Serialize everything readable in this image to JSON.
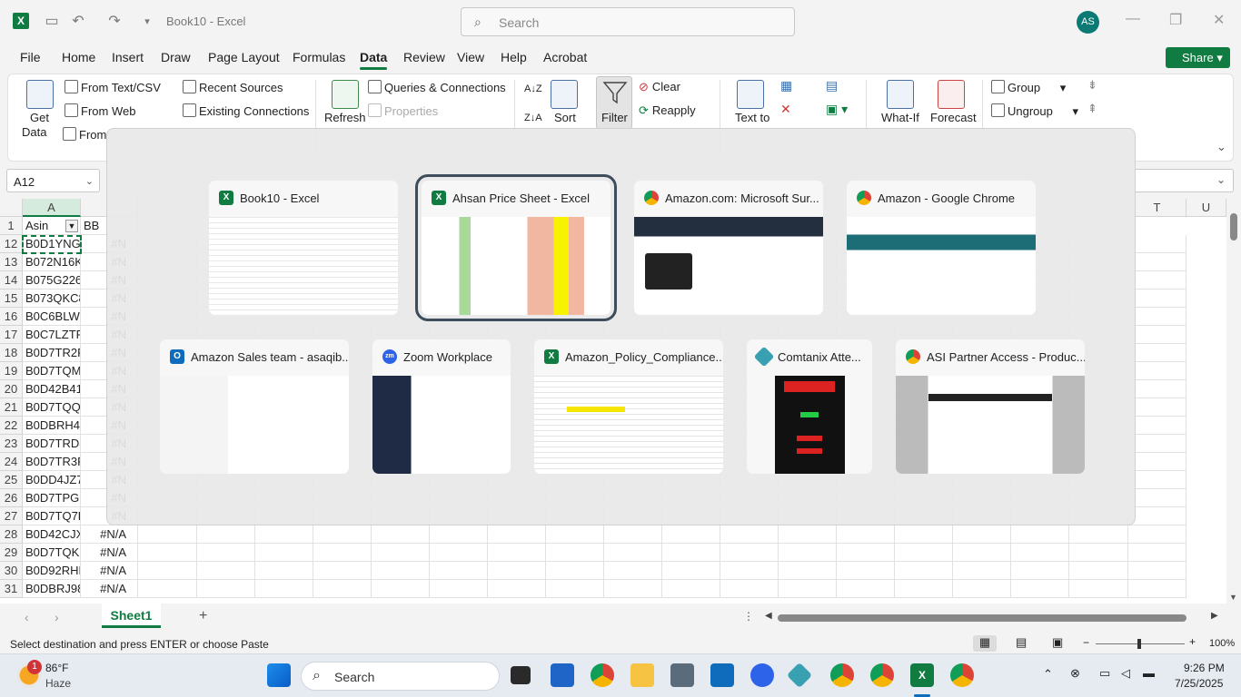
{
  "titlebar": {
    "document_title": "Book10 - Excel",
    "search_placeholder": "Search",
    "avatar_initials": "AS"
  },
  "menu": {
    "tabs": [
      "File",
      "Home",
      "Insert",
      "Draw",
      "Page Layout",
      "Formulas",
      "Data",
      "Review",
      "View",
      "Help",
      "Acrobat"
    ],
    "active": "Data",
    "share_label": "Share"
  },
  "ribbon": {
    "get_data": "Get",
    "get_data_2": "Data",
    "from_text_csv": "From Text/CSV",
    "from_web": "From Web",
    "from_partial": "From",
    "recent_sources": "Recent Sources",
    "existing_connections": "Existing Connections",
    "refresh": "Refresh",
    "queries_connections": "Queries & Connections",
    "properties": "Properties",
    "sort": "Sort",
    "filter": "Filter",
    "clear": "Clear",
    "reapply": "Reapply",
    "text_to": "Text to",
    "what_if": "What-If",
    "forecast": "Forecast",
    "group": "Group",
    "ungroup": "Ungroup"
  },
  "formula_bar": {
    "name_box": "A12"
  },
  "grid": {
    "col_a_header": "A",
    "col_t_header": "T",
    "col_u_header": "U",
    "header_row": {
      "num": "1",
      "a": "Asin",
      "b": "BB"
    },
    "rows": [
      {
        "num": "12",
        "a": "B0D1YNGV",
        "b": "#N"
      },
      {
        "num": "13",
        "a": "B072N16K",
        "b": "#N"
      },
      {
        "num": "14",
        "a": "B075G226",
        "b": "#N"
      },
      {
        "num": "15",
        "a": "B073QKC8",
        "b": "#N"
      },
      {
        "num": "16",
        "a": "B0C6BLW3",
        "b": "#N"
      },
      {
        "num": "17",
        "a": "B0C7LZTR",
        "b": "#N"
      },
      {
        "num": "18",
        "a": "B0D7TR2R",
        "b": "#N"
      },
      {
        "num": "19",
        "a": "B0D7TQM",
        "b": "#N"
      },
      {
        "num": "20",
        "a": "B0D42B41",
        "b": "#N"
      },
      {
        "num": "21",
        "a": "B0D7TQQ",
        "b": "#N"
      },
      {
        "num": "22",
        "a": "B0DBRH4N",
        "b": "#N"
      },
      {
        "num": "23",
        "a": "B0D7TRD8",
        "b": "#N"
      },
      {
        "num": "24",
        "a": "B0D7TR3F",
        "b": "#N"
      },
      {
        "num": "25",
        "a": "B0DD4JZ7",
        "b": "#N"
      },
      {
        "num": "26",
        "a": "B0D7TPGF",
        "b": "#N"
      },
      {
        "num": "27",
        "a": "B0D7TQ7R",
        "b": "#N"
      },
      {
        "num": "28",
        "a": "B0D42CJX",
        "b": "#N/A"
      },
      {
        "num": "29",
        "a": "B0D7TQKN",
        "b": "#N/A"
      },
      {
        "num": "30",
        "a": "B0D92RHD",
        "b": "#N/A"
      },
      {
        "num": "31",
        "a": "B0DBRJ98",
        "b": "#N/A"
      }
    ]
  },
  "sheets": {
    "active": "Sheet1"
  },
  "status": {
    "message": "Select destination and press ENTER or choose Paste",
    "zoom": "100%"
  },
  "switcher": {
    "windows": [
      {
        "title": "Book10 - Excel",
        "app": "excel"
      },
      {
        "title": "Ahsan Price Sheet - Excel",
        "app": "excel",
        "selected": true
      },
      {
        "title": "Amazon.com: Microsoft Sur...",
        "app": "chrome"
      },
      {
        "title": "Amazon - Google Chrome",
        "app": "chrome"
      },
      {
        "title": "Amazon Sales team - asaqib...",
        "app": "outlook"
      },
      {
        "title": "Zoom Workplace",
        "app": "zoom"
      },
      {
        "title": "Amazon_Policy_Compliance...",
        "app": "excel"
      },
      {
        "title": "Comtanix Atte...",
        "app": "comtanix"
      },
      {
        "title": "ASI Partner Access - Produc...",
        "app": "chrome"
      }
    ]
  },
  "taskbar": {
    "weather_temp": "86°F",
    "weather_desc": "Haze",
    "weather_badge": "1",
    "search_label": "Search",
    "time": "9:26 PM",
    "date": "7/25/2025"
  }
}
